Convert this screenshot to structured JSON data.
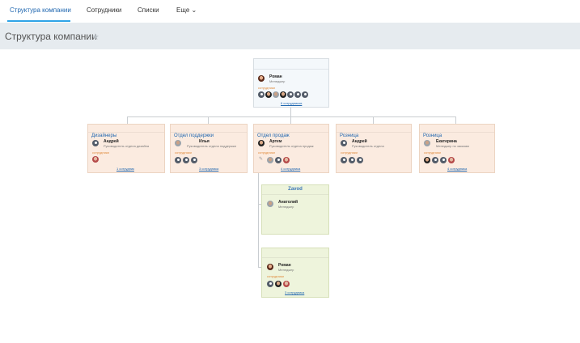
{
  "nav": {
    "tabs": [
      {
        "label": "Структура компании",
        "active": true
      },
      {
        "label": "Сотрудники",
        "active": false
      },
      {
        "label": "Списки",
        "active": false
      },
      {
        "label": "Еще ⌄",
        "active": false
      }
    ]
  },
  "page": {
    "title": "Структура компании",
    "star_icon": "star-icon"
  },
  "employees_label": "сотрудники",
  "root": {
    "manager": {
      "name": "Роман",
      "position": "Менеджер"
    },
    "employees_link": "6 сотрудников"
  },
  "departments": [
    {
      "title": "Дизайнеры",
      "manager": {
        "name": "Андрей",
        "position": "Руководитель отдела дизайна"
      },
      "employees_link": "1 сотрудник"
    },
    {
      "title": "Отдел поддержки",
      "manager": {
        "name": "Илья",
        "position": "Руководитель отдела поддержки"
      },
      "employees_link": "3 сотрудника"
    },
    {
      "title": "Отдел продаж",
      "manager": {
        "name": "Артем",
        "position": "Руководитель отдела продаж"
      },
      "employees_link": "4 сотрудника"
    },
    {
      "title": "Розница",
      "manager": {
        "name": "Андрей",
        "position": "Руководитель отдела"
      },
      "employees_link": ""
    },
    {
      "title": "Розница",
      "manager": {
        "name": "Екатерина",
        "position": "Менеджер по заказам"
      },
      "employees_link": "4 сотрудника"
    }
  ],
  "subdepartments": [
    {
      "title": "Zavod",
      "manager": {
        "name": "Анатолий",
        "position": "Менеджер"
      }
    },
    {
      "title": "",
      "manager": {
        "name": "Роман",
        "position": "Менеджер"
      },
      "employees_link": "3 сотрудника"
    }
  ],
  "colors": {
    "accent": "#2fa4e7",
    "link": "#2067b0",
    "dept_bg": "#fbebe0",
    "sub_bg": "#eef4dc",
    "employees_label": "#e08a3a"
  }
}
